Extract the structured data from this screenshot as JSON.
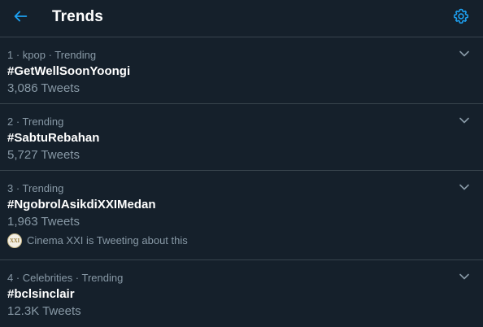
{
  "header": {
    "title": "Trends",
    "back_icon": "arrow-left-icon",
    "settings_icon": "gear-icon"
  },
  "colors": {
    "background": "#15202b",
    "accent": "#1da1f2",
    "secondary_text": "#8899a6",
    "divider": "#38444d"
  },
  "trends": [
    {
      "meta": "1 · kpop · Trending",
      "name": "#GetWellSoonYoongi",
      "count": "3,086 Tweets"
    },
    {
      "meta": "2 · Trending",
      "name": "#SabtuRebahan",
      "count": "5,727 Tweets"
    },
    {
      "meta": "3 · Trending",
      "name": "#NgobrolAsikdiXXIMedan",
      "count": "1,963 Tweets",
      "tweeting_text": "Cinema XXI is Tweeting about this",
      "tweeting_avatar_text": "XXI"
    },
    {
      "meta": "4 · Celebrities · Trending",
      "name": "#bclsinclair",
      "count": "12.3K Tweets"
    }
  ]
}
